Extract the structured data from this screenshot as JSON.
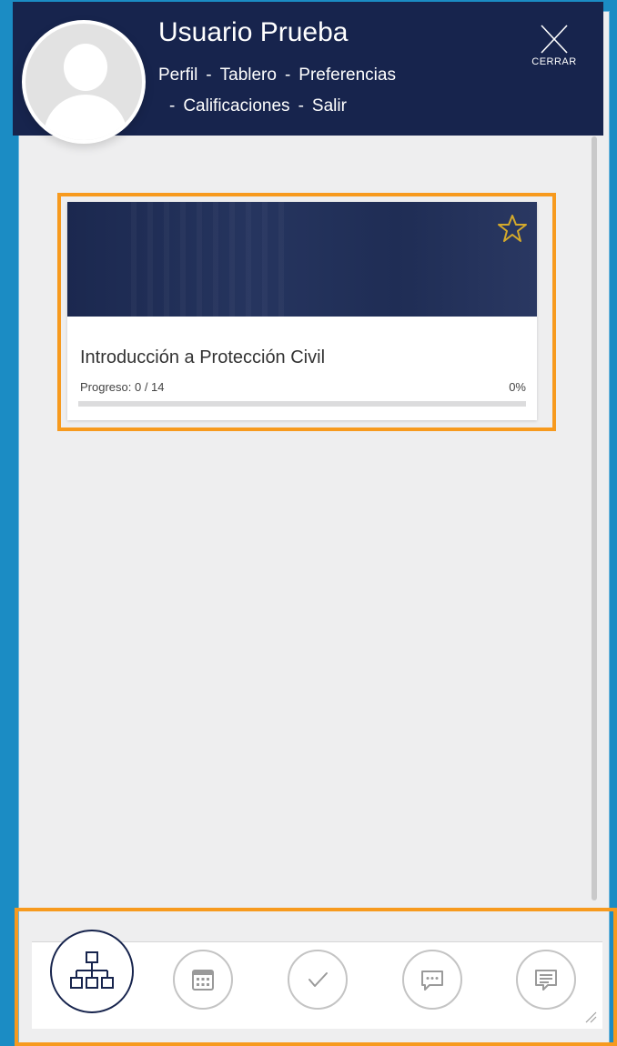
{
  "header": {
    "user_name": "Usuario Prueba",
    "links_line1": [
      "Perfil",
      "Tablero",
      "Preferencias"
    ],
    "links_line2": [
      "Calificaciones",
      "Salir"
    ],
    "separator": "-",
    "close_label": "CERRAR"
  },
  "course": {
    "title": "Introducción a Protección Civil",
    "progress_label": "Progreso: 0 / 14",
    "progress_percent": "0%",
    "progress_value": 0,
    "favorite": false
  },
  "nav": {
    "items": [
      {
        "icon": "sitemap-icon",
        "active": true
      },
      {
        "icon": "calendar-icon",
        "active": false
      },
      {
        "icon": "checkmark-icon",
        "active": false
      },
      {
        "icon": "chat-bubble-icon",
        "active": false
      },
      {
        "icon": "message-icon",
        "active": false
      }
    ]
  },
  "colors": {
    "background": "#1b8cc4",
    "header": "#17244d",
    "highlight": "#f79a1e",
    "star": "#d4a92b"
  }
}
